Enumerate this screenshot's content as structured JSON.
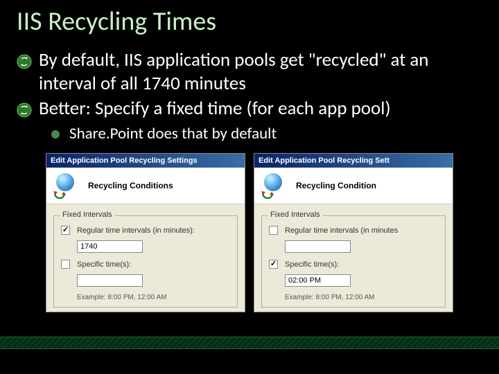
{
  "title": "IIS Recycling Times",
  "bullets": {
    "b1": "By default, IIS application pools get \"recycled\" at an interval of all 1740 minutes",
    "b2": "Better: Specify a fixed time (for each app pool)"
  },
  "sub1": "Share.Point does that by default",
  "dialog": {
    "title_full": "Edit Application Pool Recycling Settings",
    "title_trunc": "Edit Application Pool Recycling Sett",
    "header_full": "Recycling Conditions",
    "header_trunc": "Recycling Condition",
    "group_label": "Fixed Intervals",
    "interval_label_full": "Regular time intervals (in minutes):",
    "interval_label_trunc": "Regular time intervals (in minutes",
    "specific_label": "Specific time(s):",
    "example": "Example: 8:00 PM, 12:00 AM",
    "interval_value": "1740",
    "time_value": "02:00 PM",
    "empty": ""
  }
}
